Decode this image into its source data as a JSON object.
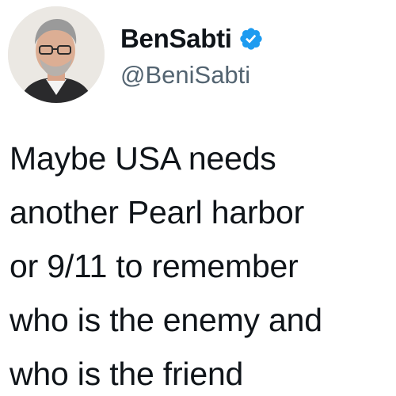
{
  "user": {
    "display_name": "BenSabti",
    "handle": "@BeniSabti",
    "verified": true,
    "verified_color": "#1d9bf0"
  },
  "tweet": {
    "text": "Maybe USA needs\nanother Pearl harbor\nor 9/11 to remember\nwho is the enemy and\nwho is the friend"
  },
  "icons": {
    "avatar": "profile-photo",
    "badge": "verified-badge-icon"
  }
}
